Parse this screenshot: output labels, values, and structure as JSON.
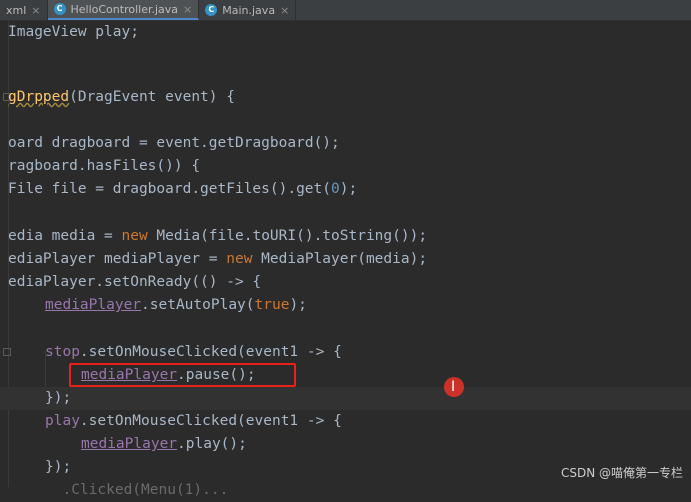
{
  "tabs": [
    {
      "label": "xml",
      "icon": "xml-file-icon",
      "active": false
    },
    {
      "label": "HelloController.java",
      "icon": "java-class-icon",
      "active": true
    },
    {
      "label": "Main.java",
      "icon": "java-class-icon",
      "active": false
    }
  ],
  "code": {
    "l1": "ImageView play;",
    "l2_name": "gDrpped",
    "l2_rest": "(DragEvent event) {",
    "l3_a": "oard dragboard = event.",
    "l3_fn": "getDragboard",
    "l3_b": "();",
    "l4": "ragboard.hasFiles()) {",
    "l5_a": "File file = dragboard.getFiles().get(",
    "l5_num": "0",
    "l5_b": ");",
    "l6_a": "edia media = ",
    "l6_kw": "new",
    "l6_b": " Media(file.toURI().toString());",
    "l7_a": "ediaPlayer mediaPlayer = ",
    "l7_kw": "new",
    "l7_b": " MediaPlayer(media);",
    "l8": "ediaPlayer.setOnReady(() -> {",
    "l9_fld": "mediaPlayer",
    "l9_a": ".setAutoPlay(",
    "l9_kw": "true",
    "l9_b": ");",
    "l10_fld": "stop",
    "l10_a": ".setOnMouseClicked(event1 -> {",
    "l11_fld": "mediaPlayer",
    "l11_a": ".pause();",
    "l12": "});",
    "l13_fld": "play",
    "l13_a": ".setOnMouseClicked(event1 -> {",
    "l14_fld": "mediaPlayer",
    "l14_a": ".play();",
    "l15": "});",
    "l16": "  .Clicked(Menu(1)..."
  },
  "watermark": "CSDN @喵俺第一专栏",
  "colors": {
    "background": "#2b2b2b",
    "keyword": "#cc7832",
    "field": "#9876aa",
    "method_decl": "#ffc66d",
    "highlight_box": "#e8221a"
  }
}
